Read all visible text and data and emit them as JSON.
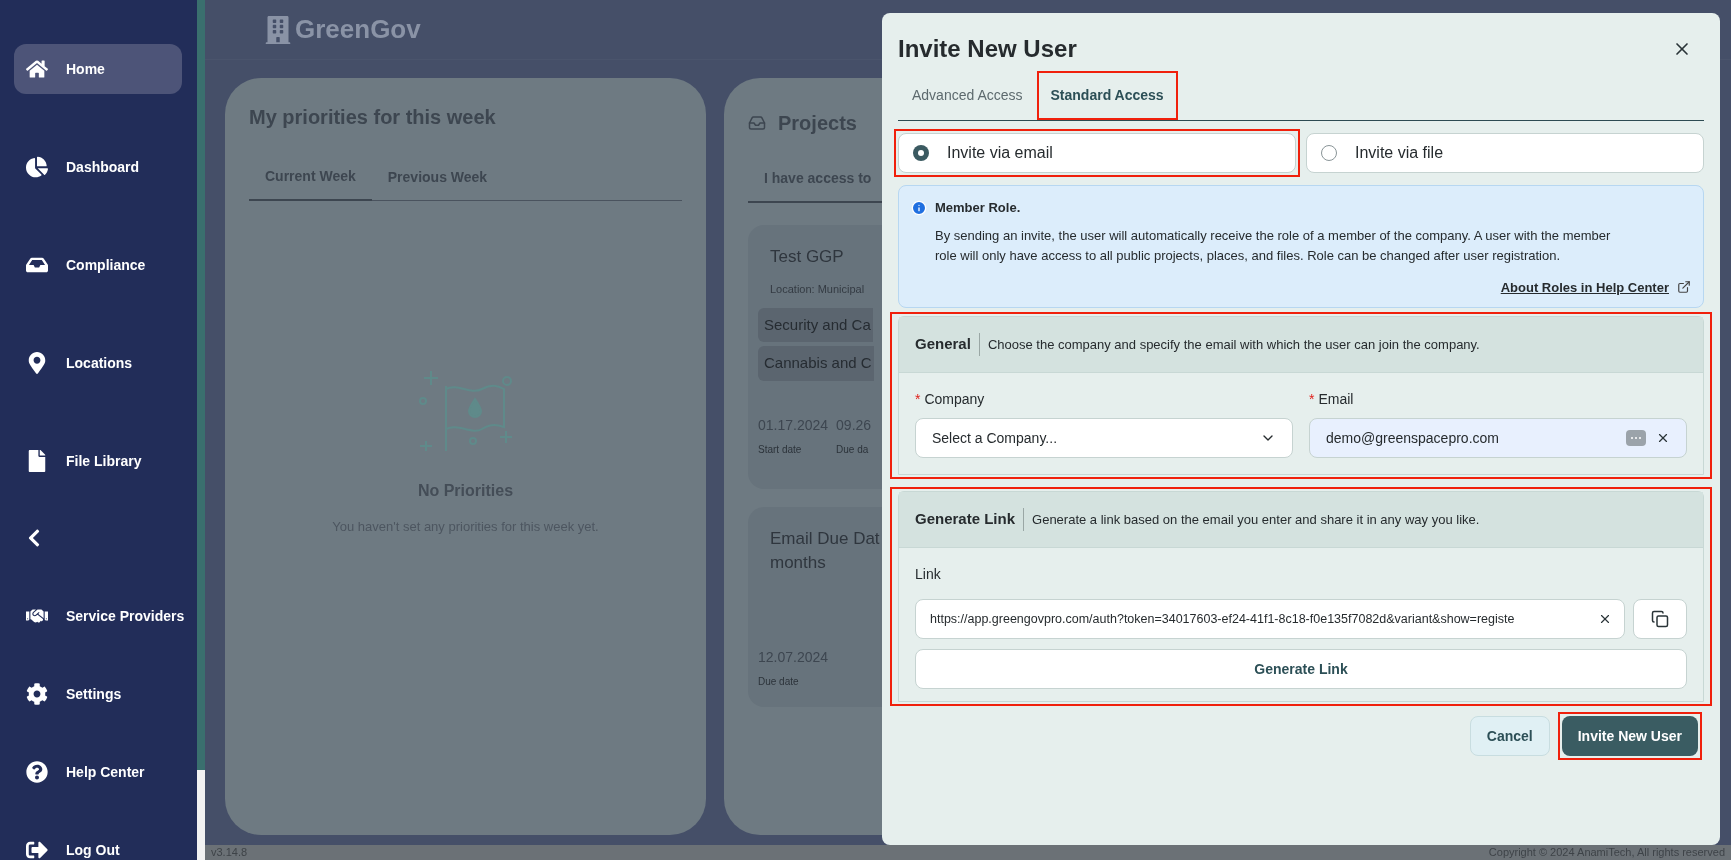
{
  "sidebar": {
    "top_items": [
      {
        "label": "Home",
        "selected": true
      },
      {
        "label": "Dashboard",
        "selected": false
      },
      {
        "label": "Compliance",
        "selected": false
      },
      {
        "label": "Locations",
        "selected": false
      },
      {
        "label": "File Library",
        "selected": false
      }
    ],
    "bottom_items": [
      {
        "label": "Service Providers",
        "selected": false
      },
      {
        "label": "Settings",
        "selected": false
      },
      {
        "label": "Help Center",
        "selected": false
      },
      {
        "label": "Log Out",
        "selected": false
      }
    ]
  },
  "header": {
    "logo": "GreenGov"
  },
  "priorities": {
    "title": "My priorities for this week",
    "tabs": [
      {
        "label": "Current Week",
        "selected": true
      },
      {
        "label": "Previous Week",
        "selected": false
      }
    ],
    "empty_title": "No Priorities",
    "empty_text": "You haven't set any priorities for this week yet."
  },
  "projects": {
    "title": "Projects",
    "tabs": [
      {
        "label": "I have access to",
        "selected": true
      }
    ],
    "cards": [
      {
        "title_lines": [
          "Test GGP"
        ],
        "location": "Location: Municipal",
        "tags": [
          "Security and Ca",
          "Cannabis and C"
        ],
        "dates": [
          {
            "value": "01.17.2024",
            "label": "Start date"
          },
          {
            "value": "09.26",
            "label": "Due da"
          }
        ]
      },
      {
        "title_lines": [
          "Email Due Dat",
          "months"
        ],
        "dates": [
          {
            "value": "12.07.2024",
            "label": "Due date"
          }
        ]
      }
    ]
  },
  "footer": {
    "version": "v3.14.8",
    "copyright": "Copyright © 2024 AnamiTech, All rights reserved"
  },
  "dialog": {
    "title": "Invite New User",
    "tabs": [
      {
        "label": "Advanced Access",
        "selected": false,
        "highlighted": false
      },
      {
        "label": "Standard Access",
        "selected": true,
        "highlighted": true
      }
    ],
    "options": [
      {
        "label": "Invite via email",
        "selected": true,
        "highlighted": true
      },
      {
        "label": "Invite via file",
        "selected": false,
        "highlighted": false
      }
    ],
    "info": {
      "title": "Member Role.",
      "text": "By sending an invite, the user will automatically receive the role of a member of the company. A user with the member role will only have access to all public projects, places, and files. Role can be changed after user registration.",
      "link": "About Roles in Help Center"
    },
    "general": {
      "title": "General",
      "description": "Choose the company and specify the email with which the user can join the company.",
      "highlighted": true,
      "company": {
        "required_mark": "*",
        "label": "Company",
        "placeholder": "Select a Company..."
      },
      "email": {
        "required_mark": "*",
        "label": "Email",
        "value": "demo@greenspacepro.com"
      }
    },
    "link_section": {
      "title": "Generate Link",
      "description": "Generate a link based on the email you enter and share it in any way you like.",
      "highlighted": true,
      "label": "Link",
      "value": "https://app.greengovpro.com/auth?token=34017603-ef24-41f1-8c18-f0e135f7082d&variant&show=registe",
      "button": "Generate Link"
    },
    "buttons": [
      {
        "label": "Cancel",
        "kind": "secondary",
        "highlighted": false
      },
      {
        "label": "Invite New User",
        "kind": "primary",
        "highlighted": true
      }
    ]
  }
}
